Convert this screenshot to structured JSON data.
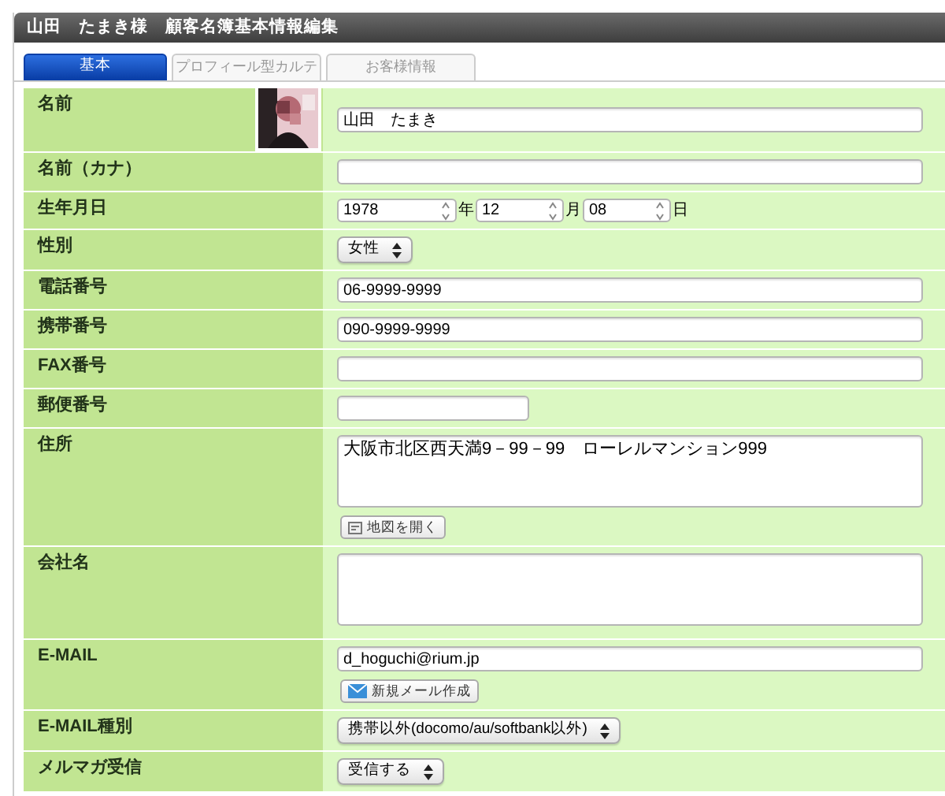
{
  "window": {
    "title": "山田　たまき様　顧客名簿基本情報編集"
  },
  "tabs": [
    {
      "label": "基本",
      "selected": true
    },
    {
      "label": "プロフィール型カルテ",
      "selected": false
    },
    {
      "label": "お客様情報",
      "selected": false
    }
  ],
  "rows": [
    {
      "label": "名前",
      "kind": "text",
      "value": "山田　たまき"
    },
    {
      "label": "名前（カナ）",
      "kind": "text"
    },
    {
      "label": "生年月日",
      "kind": "date",
      "fields": [
        {
          "value": "1978",
          "unit": "年"
        },
        {
          "value": "12",
          "unit": "月"
        },
        {
          "value": "08",
          "unit": "日"
        }
      ]
    },
    {
      "label": "性別",
      "kind": "select",
      "value": "女性"
    },
    {
      "label": "電話番号",
      "kind": "text",
      "value": "06-9999-9999"
    },
    {
      "label": "携帯番号",
      "kind": "text",
      "value": "090-9999-9999"
    },
    {
      "label": "FAX番号",
      "kind": "text"
    },
    {
      "label": "郵便番号",
      "kind": "short-text"
    },
    {
      "label": "住所",
      "kind": "textarea",
      "value": "大阪市北区西天満9－99－99　ローレルマンション999",
      "button": {
        "label": "地図を開く",
        "kind": "map"
      }
    },
    {
      "label": "会社名",
      "kind": "textarea"
    },
    {
      "label": "E-MAIL",
      "kind": "text",
      "value": "d_hoguchi@rium.jp",
      "button": {
        "label": "新規メール作成",
        "kind": "mail"
      }
    },
    {
      "label": "E-MAIL種別",
      "kind": "select",
      "value": "携帯以外(docomo/au/softbank以外)"
    },
    {
      "label": "メルマガ受信",
      "kind": "select",
      "value": "受信する"
    }
  ]
}
